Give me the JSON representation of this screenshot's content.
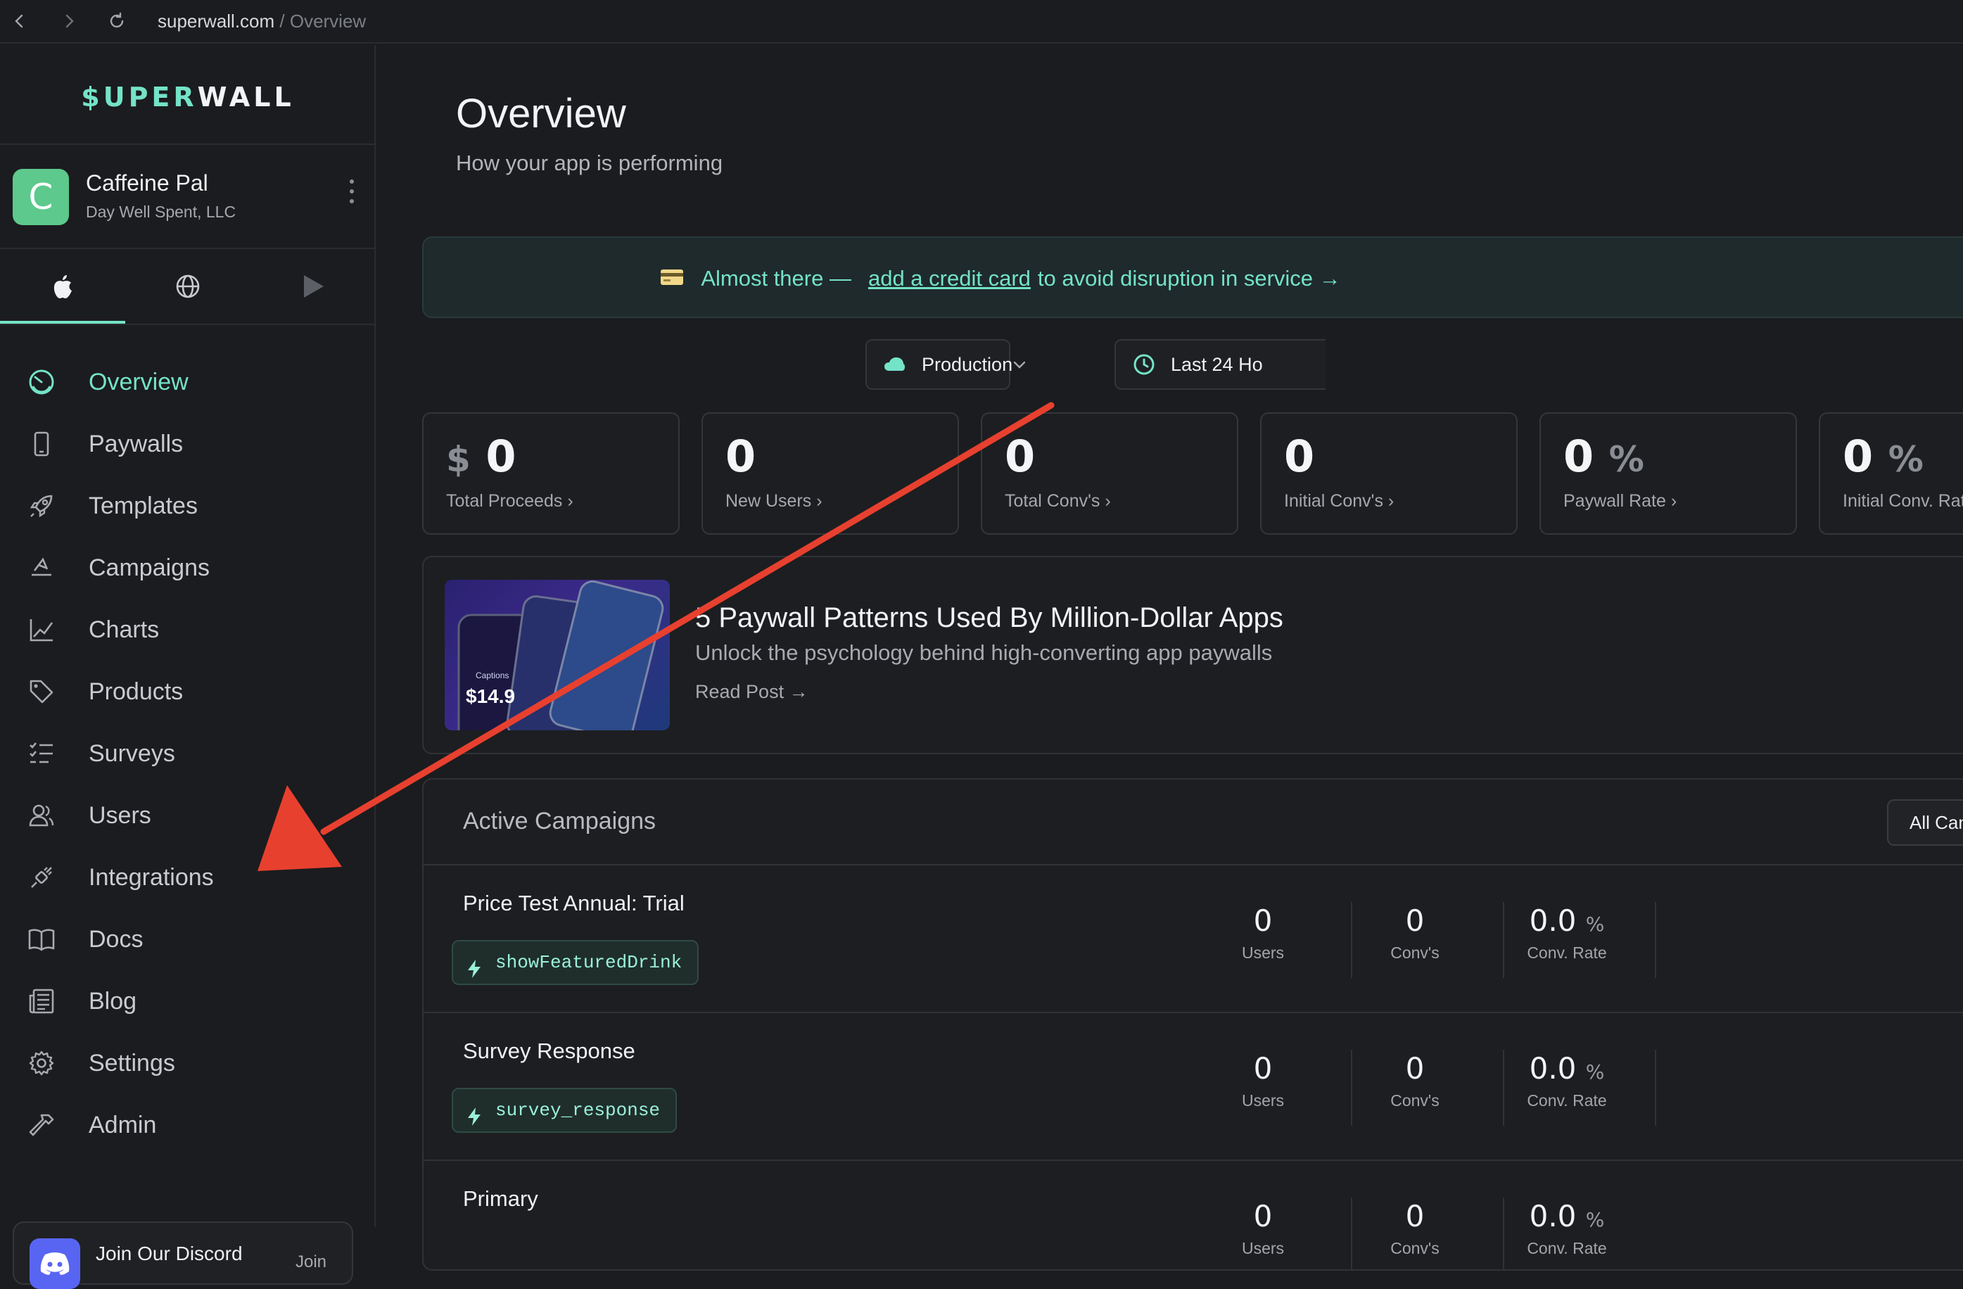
{
  "browser": {
    "domain": "superwall.com",
    "crumb": " / Overview"
  },
  "sidebar": {
    "logo_accent": "$UPER",
    "logo_rest": "WALL",
    "app": {
      "avatar_letter": "C",
      "name": "Caffeine Pal",
      "org": "Day Well Spent, LLC"
    },
    "platform_tabs": [
      {
        "name": "apple-icon",
        "active": true
      },
      {
        "name": "globe-icon",
        "active": false
      },
      {
        "name": "play-store-icon",
        "active": false
      }
    ],
    "items": [
      {
        "label": "Overview",
        "icon": "gauge-icon",
        "active": true
      },
      {
        "label": "Paywalls",
        "icon": "phone-icon"
      },
      {
        "label": "Templates",
        "icon": "rocket-icon"
      },
      {
        "label": "Campaigns",
        "icon": "megaphone-icon"
      },
      {
        "label": "Charts",
        "icon": "chart-line-icon"
      },
      {
        "label": "Products",
        "icon": "tag-icon"
      },
      {
        "label": "Surveys",
        "icon": "checklist-icon"
      },
      {
        "label": "Users",
        "icon": "users-icon"
      },
      {
        "label": "Integrations",
        "icon": "plug-icon"
      },
      {
        "label": "Docs",
        "icon": "book-icon"
      },
      {
        "label": "Blog",
        "icon": "newspaper-icon"
      },
      {
        "label": "Settings",
        "icon": "gear-icon"
      },
      {
        "label": "Admin",
        "icon": "hammer-icon"
      }
    ],
    "discord": {
      "title": "Join Our Discord",
      "join_label": "Join"
    }
  },
  "main": {
    "title": "Overview",
    "subtitle": "How your app is performing",
    "banner": {
      "prefix": "Almost there —",
      "link": "add a credit card",
      "suffix": "to avoid disruption in service →"
    },
    "environment": "Production",
    "time_range": "Last 24 Ho",
    "stats": [
      {
        "prefix": "$",
        "value": "0",
        "suffix": "",
        "label": "Total Proceeds"
      },
      {
        "prefix": "",
        "value": "0",
        "suffix": "",
        "label": "New Users"
      },
      {
        "prefix": "",
        "value": "0",
        "suffix": "",
        "label": "Total Conv's"
      },
      {
        "prefix": "",
        "value": "0",
        "suffix": "",
        "label": "Initial Conv's"
      },
      {
        "prefix": "",
        "value": "0",
        "suffix": "%",
        "label": "Paywall Rate"
      },
      {
        "prefix": "",
        "value": "0",
        "suffix": "%",
        "label": "Initial Conv. Rat"
      }
    ],
    "blog": {
      "title": "5 Paywall Patterns Used By Million-Dollar Apps",
      "subtitle": "Unlock the psychology behind high-converting app paywalls",
      "link": "Read Post →",
      "thumb_price": "$14.9",
      "thumb_caption": "Captions"
    },
    "campaigns": {
      "title": "Active Campaigns",
      "filter": "All Campa",
      "rows": [
        {
          "name": "Price Test Annual: Trial",
          "tag": "showFeaturedDrink",
          "users": "0",
          "convs": "0",
          "rate": "0.0"
        },
        {
          "name": "Survey Response",
          "tag": "survey_response",
          "users": "0",
          "convs": "0",
          "rate": "0.0"
        },
        {
          "name": "Primary",
          "tag": "",
          "users": "0",
          "convs": "0",
          "rate": "0.0"
        }
      ],
      "metric_labels": {
        "users": "Users",
        "convs": "Conv's",
        "rate": "Conv. Rate",
        "pct": "%"
      }
    }
  },
  "colors": {
    "accent": "#74e3c8",
    "background": "#1b1c1f",
    "annotation_arrow": "#e8402f"
  }
}
